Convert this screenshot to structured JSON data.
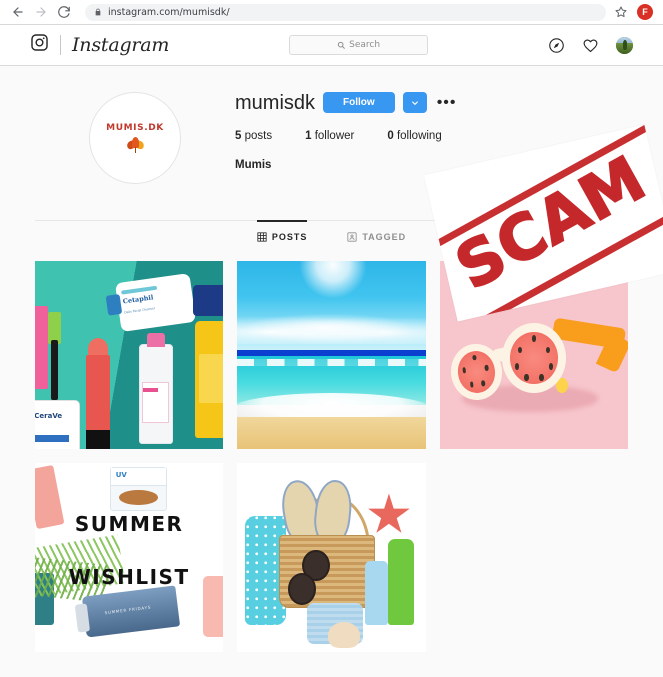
{
  "browser": {
    "back_icon": "back-arrow-icon",
    "forward_icon": "forward-arrow-icon",
    "reload_icon": "reload-icon",
    "lock_icon": "lock-icon",
    "url": "instagram.com/mumisdk/",
    "star_icon": "bookmark-star-icon",
    "profile_initial": "F"
  },
  "nav": {
    "camera_icon": "instagram-camera-icon",
    "wordmark": "Instagram",
    "search": {
      "placeholder": "Search",
      "icon": "search-icon"
    },
    "explore_icon": "compass-icon",
    "activity_icon": "heart-icon",
    "avatar_icon": "user-avatar"
  },
  "profile": {
    "avatar": {
      "title": "MUMIS.DK",
      "logo_icon": "maple-leaf-icon"
    },
    "username": "mumisdk",
    "follow_label": "Follow",
    "caret_icon": "chevron-down-icon",
    "options_icon": "ellipsis-icon",
    "options_label": "•••",
    "stats": [
      {
        "value": "5",
        "label": "posts"
      },
      {
        "value": "1",
        "label": "follower"
      },
      {
        "value": "0",
        "label": "following"
      }
    ],
    "bio": "Mumis"
  },
  "tabs": [
    {
      "label": "POSTS",
      "icon": "grid-icon",
      "active": true
    },
    {
      "label": "TAGGED",
      "icon": "tag-person-icon",
      "active": false
    }
  ],
  "posts": [
    {
      "name": "post-cosmetics-flatlay",
      "alt": "Cosmetic products on teal background"
    },
    {
      "name": "post-beach-ocean",
      "alt": "Tropical beach with turquoise sea and sand"
    },
    {
      "name": "post-watermelon-sunglasses",
      "alt": "Watermelon lens sunglasses on pink background"
    },
    {
      "name": "post-summer-wishlist",
      "alt": "Summer Wishlist text with beauty products"
    },
    {
      "name": "post-beach-basket",
      "alt": "Beach basket with flip flops, starfish and bottles"
    }
  ],
  "post_art": {
    "cosmetics": {
      "cetaphil_brand": "Cetaphil",
      "cetaphil_sub": "Daily Facial Cleanser",
      "cerave_brand": "CeraVe"
    },
    "wishlist": {
      "line1": "SUMMER",
      "line2": "WISHLIST",
      "jar_label": "UV",
      "tube_label": "SUMMER FRIDAYS"
    }
  },
  "overlay": {
    "stamp_text": "SCAM",
    "stamp_color": "#c1181b"
  },
  "colors": {
    "instagram_blue": "#3897f0",
    "page_background": "#fafafa",
    "text_primary": "#262626",
    "text_secondary": "#8e8e8e"
  }
}
